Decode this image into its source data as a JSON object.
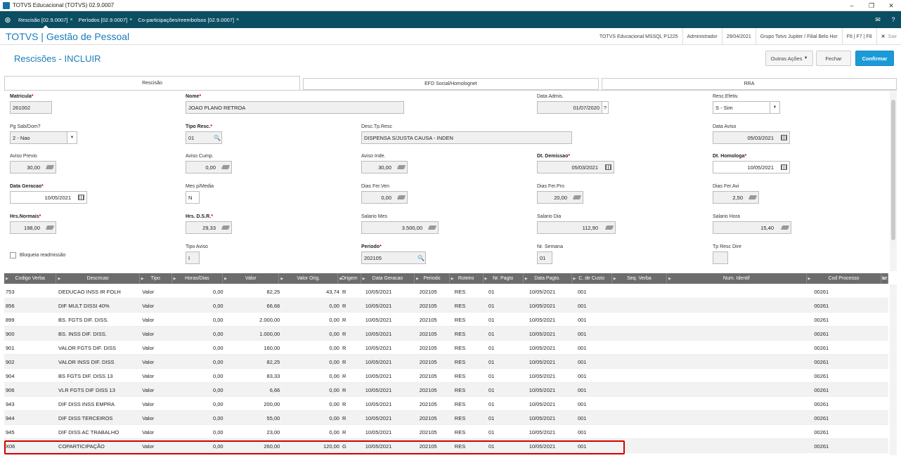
{
  "window": {
    "title": "TOTVS Educacional (TOTVS) 02.9.0007",
    "minimize": "–",
    "maximize": "❐",
    "close": "✕"
  },
  "tabs": [
    {
      "label": "Rescisão [02.9.0007]",
      "close": "×"
    },
    {
      "label": "Períodos [02.9.0007]",
      "close": "×"
    },
    {
      "label": "Co-participações/reembolsos [02.9.0007]",
      "close": "×"
    }
  ],
  "tabbar_icons": {
    "home": "⊛",
    "mail": "✉",
    "help": "?"
  },
  "header": {
    "title": "TOTVS | Gestão de Pessoal",
    "env": "TOTVS Educacional MSSQL P1225",
    "user": "Administrador",
    "date": "29/04/2021",
    "company": "Grupo Totvs Jupiter / Filial Belo Hor",
    "keys": "F6 | F7 | F8",
    "exit": "Sair",
    "exit_icon": "✕"
  },
  "page": {
    "title": "Rescisões - INCLUIR",
    "btn_more": "Outras Ações",
    "btn_close": "Fechar",
    "btn_confirm": "Confirmar"
  },
  "form_tabs": [
    "Rescisão",
    "EFD Social/Homolognet",
    "RRA"
  ],
  "fields": {
    "matricula": {
      "label": "Matricula",
      "value": "261002"
    },
    "nome": {
      "label": "Nome",
      "value": "JOAO PLANO RETROA"
    },
    "data_admis": {
      "label": "Data Admis.",
      "value": "01/07/2020",
      "help": "?"
    },
    "resc_efetiv": {
      "label": "Resc.Efetiv.",
      "value": "S - Sim"
    },
    "pg_sab_dom": {
      "label": "Pg Sab/Dom?",
      "value": "2 - Nao"
    },
    "tipo_resc": {
      "label": "Tipo Resc.",
      "value": "01"
    },
    "desc_tp_resc": {
      "label": "Desc.Tp.Resc",
      "value": "DISPENSA S/JUSTA CAUSA - INDEN"
    },
    "data_aviso": {
      "label": "Data Aviso",
      "value": "05/03/2021"
    },
    "aviso_previo": {
      "label": "Aviso Previo",
      "value": "30,00"
    },
    "aviso_cump": {
      "label": "Aviso Cump.",
      "value": "0,00"
    },
    "aviso_inde": {
      "label": "Aviso Inde.",
      "value": "30,00"
    },
    "dt_demissao": {
      "label": "Dt. Demissao",
      "value": "05/03/2021"
    },
    "dt_homologa": {
      "label": "Dt. Homologa",
      "value": "10/05/2021"
    },
    "data_geracao": {
      "label": "Data Geracao",
      "value": "10/05/2021"
    },
    "mes_p_media": {
      "label": "Mes p/Media",
      "value": "N"
    },
    "dias_fer_ven": {
      "label": "Dias Fer.Ven",
      "value": "0,00"
    },
    "dias_fer_pro": {
      "label": "Dias Fer.Pro",
      "value": "20,00"
    },
    "dias_fer_avi": {
      "label": "Dias Fer.Avi",
      "value": "2,50"
    },
    "hrs_normais": {
      "label": "Hrs.Normais",
      "value": "198,00"
    },
    "hrs_dsr": {
      "label": "Hrs. D.S.R.",
      "value": "29,33"
    },
    "salario_mes": {
      "label": "Salario Mes",
      "value": "3.500,00"
    },
    "salario_dia": {
      "label": "Salario Dia",
      "value": "112,90"
    },
    "salario_hora": {
      "label": "Salario Hora",
      "value": "15,40"
    },
    "bloqueia": {
      "label": "Bloqueia readmissão"
    },
    "tipo_aviso": {
      "label": "Tipo Aviso",
      "value": "I"
    },
    "periodo": {
      "label": "Periodo",
      "value": "202105"
    },
    "nr_semana": {
      "label": "Nr. Semana",
      "value": "01"
    },
    "tp_resc_dire": {
      "label": "Tp Resc Dire",
      "value": ""
    }
  },
  "grid": {
    "columns": [
      "Codigo Verba",
      "Descricao",
      "Tipo",
      "Horas/Dias",
      "Valor",
      "Valor Orig.",
      "Origem",
      "Data Geracao",
      "Periodo",
      "Roteiro",
      "Nr. Pagto",
      "Data Pagto.",
      "C. de Custo",
      "Seq. Verba",
      "Num. Identif",
      "Cod Processo",
      "Ite"
    ],
    "rows": [
      [
        "753",
        "DEDUCAO INSS IR FOLH",
        "Valor",
        "0,00",
        "82,25",
        "43,74",
        "R",
        "10/05/2021",
        "202105",
        "RES",
        "01",
        "10/05/2021",
        "001",
        "",
        "",
        "00261"
      ],
      [
        "856",
        "DIF MULT DISSI 40%",
        "Valor",
        "0,00",
        "66,66",
        "0,00",
        "R",
        "10/05/2021",
        "202105",
        "RES",
        "01",
        "10/05/2021",
        "001",
        "",
        "",
        "00261"
      ],
      [
        "899",
        "BS. FGTS DIF. DISS.",
        "Valor",
        "0,00",
        "2.000,00",
        "0,00",
        "R",
        "10/05/2021",
        "202105",
        "RES",
        "01",
        "10/05/2021",
        "001",
        "",
        "",
        "00261"
      ],
      [
        "900",
        "BS. INSS DIF. DISS.",
        "Valor",
        "0,00",
        "1.000,00",
        "0,00",
        "R",
        "10/05/2021",
        "202105",
        "RES",
        "01",
        "10/05/2021",
        "001",
        "",
        "",
        "00261"
      ],
      [
        "901",
        "VALOR FGTS DIF. DISS",
        "Valor",
        "0,00",
        "160,00",
        "0,00",
        "R",
        "10/05/2021",
        "202105",
        "RES",
        "01",
        "10/05/2021",
        "001",
        "",
        "",
        "00261"
      ],
      [
        "902",
        "VALOR INSS DIF. DISS",
        "Valor",
        "0,00",
        "82,25",
        "0,00",
        "R",
        "10/05/2021",
        "202105",
        "RES",
        "01",
        "10/05/2021",
        "001",
        "",
        "",
        "00261"
      ],
      [
        "904",
        "BS FGTS DIF. DISS 13",
        "Valor",
        "0,00",
        "83,33",
        "0,00",
        "R",
        "10/05/2021",
        "202105",
        "RES",
        "01",
        "10/05/2021",
        "001",
        "",
        "",
        "00261"
      ],
      [
        "906",
        "VLR FGTS DIF DISS 13",
        "Valor",
        "0,00",
        "6,66",
        "0,00",
        "R",
        "10/05/2021",
        "202105",
        "RES",
        "01",
        "10/05/2021",
        "001",
        "",
        "",
        "00261"
      ],
      [
        "943",
        "DIF DISS INSS EMPRA",
        "Valor",
        "0,00",
        "200,00",
        "0,00",
        "R",
        "10/05/2021",
        "202105",
        "RES",
        "01",
        "10/05/2021",
        "001",
        "",
        "",
        "00261"
      ],
      [
        "944",
        "DIF DISS TERCEIROS",
        "Valor",
        "0,00",
        "55,00",
        "0,00",
        "R",
        "10/05/2021",
        "202105",
        "RES",
        "01",
        "10/05/2021",
        "001",
        "",
        "",
        "00261"
      ],
      [
        "945",
        "DIF DISS AC TRABALHO",
        "Valor",
        "0,00",
        "23,00",
        "0,00",
        "R",
        "10/05/2021",
        "202105",
        "RES",
        "01",
        "10/05/2021",
        "001",
        "",
        "",
        "00261"
      ],
      [
        "X06",
        "COPARTICIPAÇÃO",
        "Valor",
        "0,00",
        "260,00",
        "120,00",
        "G",
        "10/05/2021",
        "202105",
        "RES",
        "01",
        "10/05/2021",
        "001",
        "",
        "",
        "00261"
      ]
    ]
  },
  "colors": {
    "accent": "#1a7bbd",
    "tabbar": "#0b4d61",
    "highlight": "#d40000",
    "grid_header": "#6c6c6c"
  }
}
